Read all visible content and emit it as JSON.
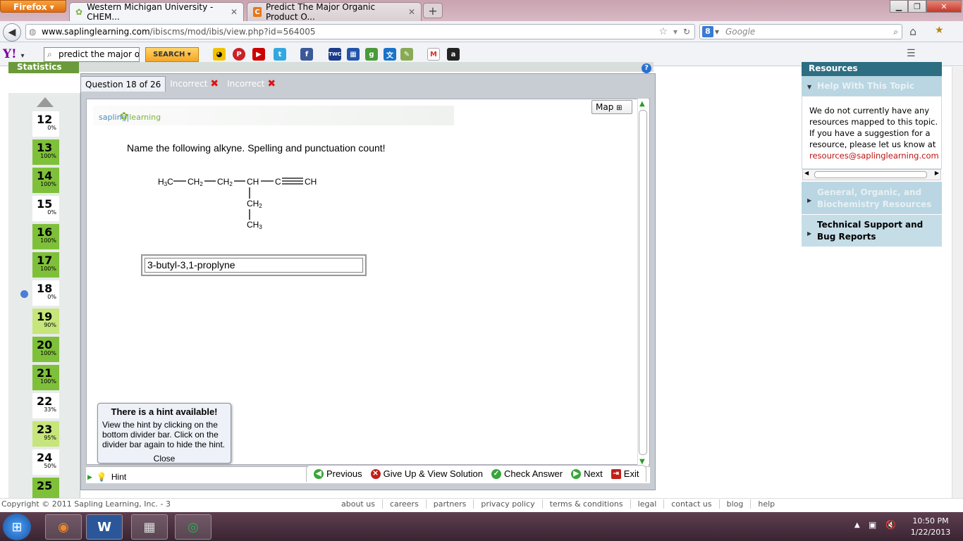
{
  "browser": {
    "app_button": "Firefox",
    "tabs": [
      {
        "label": "Western Michigan University - CHEM...",
        "active": true
      },
      {
        "label": "Predict The Major Organic Product O...",
        "active": false
      }
    ],
    "url_host": "www.saplinglearning.com",
    "url_path": "/ibiscms/mod/ibis/view.php?id=564005",
    "search_placeholder": "Google",
    "yahoo_logo": "Y!",
    "yahoo_search_value": "predict the major org",
    "yahoo_search_button": "SEARCH"
  },
  "left_nav": {
    "stats_label": "Statistics",
    "questions": [
      {
        "num": "12",
        "pct": "0%",
        "state": "none"
      },
      {
        "num": "13",
        "pct": "100%",
        "state": "done"
      },
      {
        "num": "14",
        "pct": "100%",
        "state": "done"
      },
      {
        "num": "15",
        "pct": "0%",
        "state": "none"
      },
      {
        "num": "16",
        "pct": "100%",
        "state": "done"
      },
      {
        "num": "17",
        "pct": "100%",
        "state": "done"
      },
      {
        "num": "18",
        "pct": "0%",
        "state": "current"
      },
      {
        "num": "19",
        "pct": "90%",
        "state": "partial"
      },
      {
        "num": "20",
        "pct": "100%",
        "state": "done"
      },
      {
        "num": "21",
        "pct": "100%",
        "state": "done"
      },
      {
        "num": "22",
        "pct": "33%",
        "state": "none"
      },
      {
        "num": "23",
        "pct": "95%",
        "state": "partial"
      },
      {
        "num": "24",
        "pct": "50%",
        "state": "none"
      },
      {
        "num": "25",
        "pct": "",
        "state": "done"
      }
    ]
  },
  "question": {
    "counter": "Question 18 of 26",
    "attempt_tabs": [
      "Incorrect",
      "Incorrect"
    ],
    "logo_left": "sapling",
    "logo_right": "learning",
    "map_label": "Map",
    "prompt": "Name the following alkyne. Spelling and punctuation count!",
    "structure": {
      "chain": [
        "H3C",
        "CH2",
        "CH2",
        "CH",
        "C",
        "CH"
      ],
      "branch": [
        "CH2",
        "CH3"
      ]
    },
    "answer_value": "3-butyl-3,1-proplyne"
  },
  "hint": {
    "title": "There is a hint available!",
    "body": "View the hint by clicking on the bottom divider bar. Click on the divider bar again to hide the hint.",
    "close": "Close",
    "button": "Hint"
  },
  "actions": {
    "previous": "Previous",
    "giveup": "Give Up & View Solution",
    "check": "Check Answer",
    "next": "Next",
    "exit": "Exit"
  },
  "sidebar": {
    "resources_title": "Resources",
    "help_topic": "Help With This Topic",
    "message": "We do not currently have any resources mapped to this topic. If you have a suggestion for a resource, please let us know at",
    "email": "resources@saplinglearning.com",
    "general": "General, Organic, and Biochemistry Resources",
    "tech": "Technical Support and Bug Reports"
  },
  "footer": {
    "copyright": "Copyright © 2011 Sapling Learning, Inc. - 3",
    "links": [
      "about us",
      "careers",
      "partners",
      "privacy policy",
      "terms & conditions",
      "legal",
      "contact us",
      "blog",
      "help"
    ]
  },
  "taskbar": {
    "time": "10:50 PM",
    "date": "1/22/2013"
  },
  "colors": {
    "done": "#7fc03a",
    "partial": "#c6e57a",
    "current_dot": "#4a7fd8",
    "resources": "#2d6e82"
  }
}
